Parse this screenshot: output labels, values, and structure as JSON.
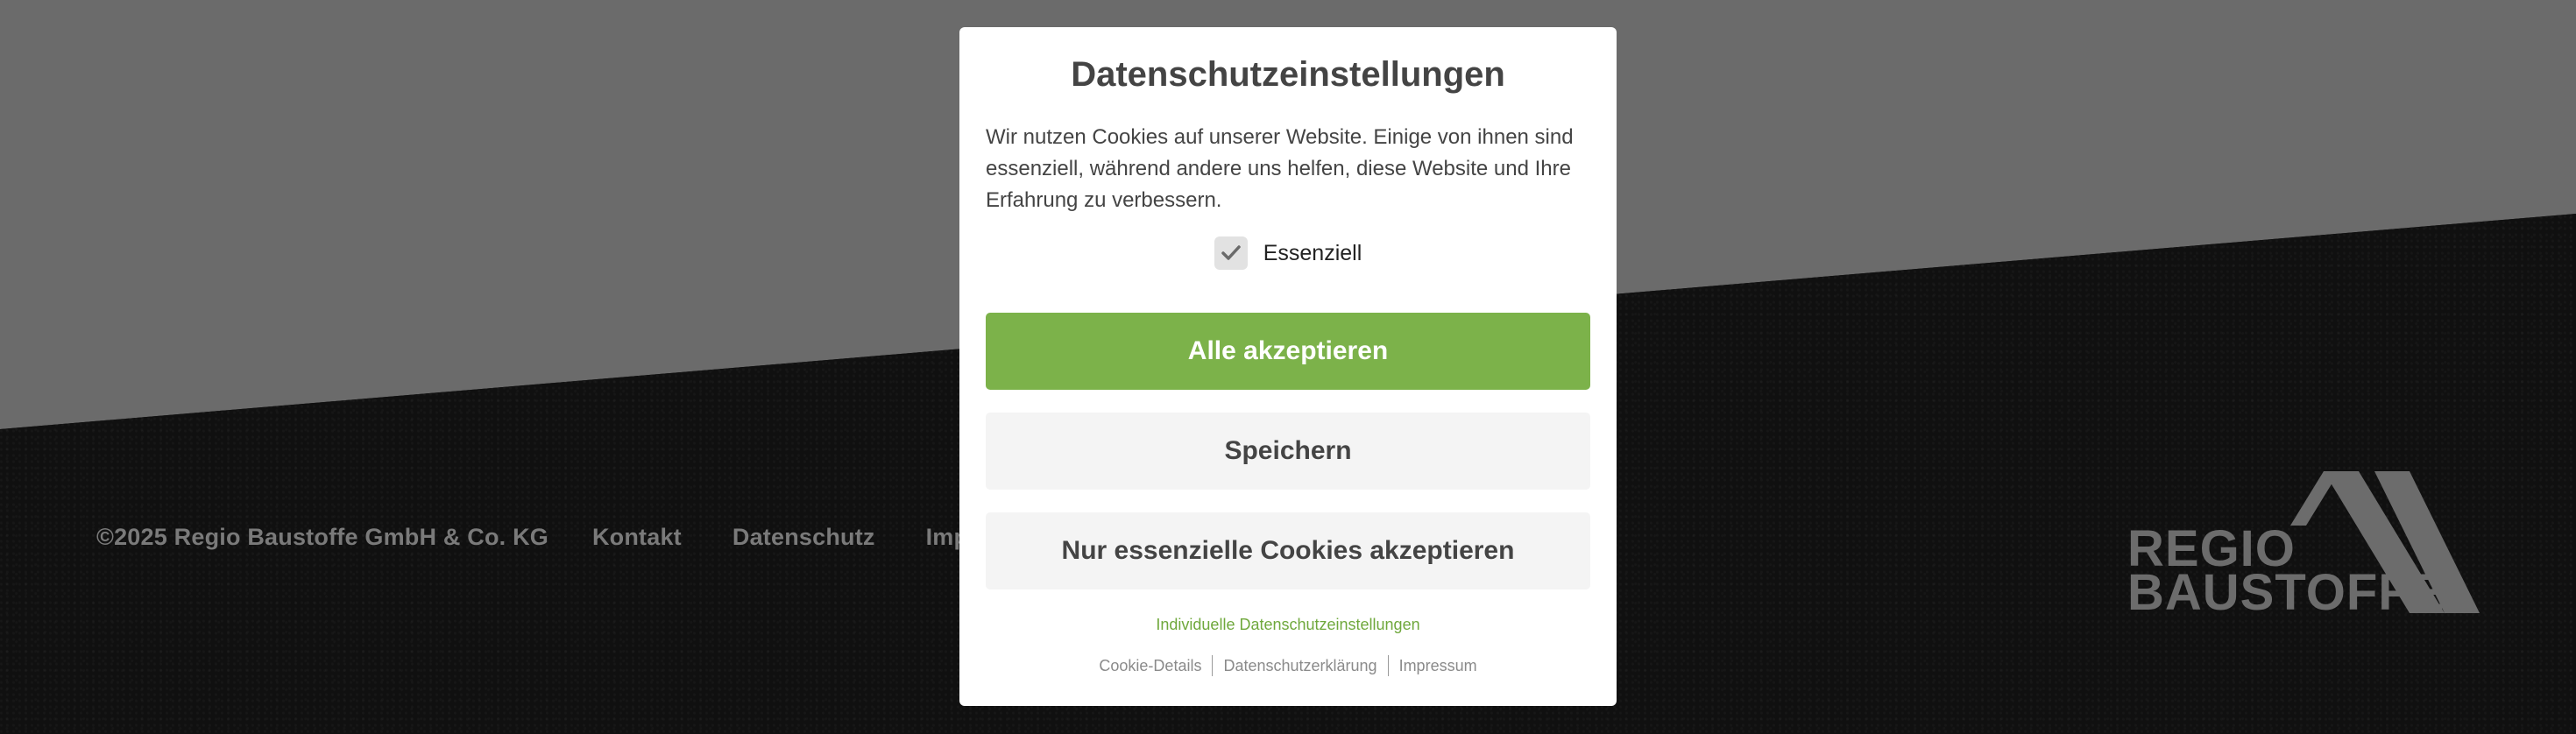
{
  "footer": {
    "copyright": "©2025 Regio Baustoffe GmbH & Co. KG",
    "links": [
      "Kontakt",
      "Datenschutz",
      "Impressum"
    ]
  },
  "logo": {
    "line1": "REGIO",
    "line2": "BAUSTOFFE"
  },
  "modal": {
    "title": "Datenschutzeinstellungen",
    "text": "Wir nutzen Cookies auf unserer Website. Einige von ihnen sind essenziell, während andere uns helfen, diese Website und Ihre Erfahrung zu verbessern.",
    "checkbox_label": "Essenziell",
    "accept_all": "Alle akzeptieren",
    "save": "Speichern",
    "essential_only": "Nur essenzielle Cookies akzeptieren",
    "individual_settings": "Individuelle Datenschutzeinstellungen",
    "sublinks": [
      "Cookie-Details",
      "Datenschutzerklärung",
      "Impressum"
    ]
  },
  "colors": {
    "accent": "#7cb24a",
    "background_gray": "#6b6b6b",
    "background_dark": "#101010"
  }
}
